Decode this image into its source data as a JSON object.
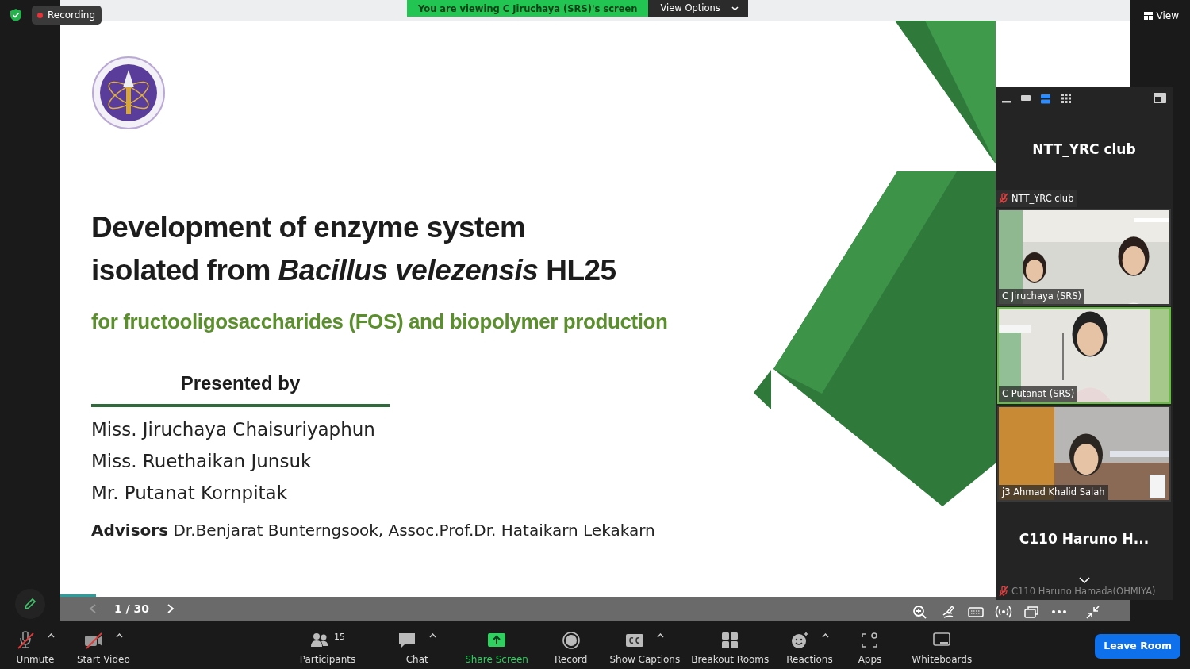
{
  "top_bar": {
    "recording_label": "Recording",
    "banner": "You are viewing C Jiruchaya (SRS)'s screen",
    "view_options": "View Options",
    "view_button": "View"
  },
  "slide": {
    "title_lines": [
      "Development of enzyme system",
      "isolated from *Bacillus velezensis* HL25"
    ],
    "subtitle": "for fructooligosaccharides (FOS) and biopolymer production",
    "presented_by": "Presented by",
    "presenters": [
      "Miss. Jiruchaya Chaisuriyaphun",
      "Miss. Ruethaikan Junsuk",
      "Mr. Putanat Kornpitak"
    ],
    "advisors": "**Advisors** Dr.Benjarat Bunterngsook, Assoc.Prof.Dr. Hataikarn Lekakarn"
  },
  "share_controls": {
    "page": "1 / 30",
    "level": 0.033
  },
  "video_panel": {
    "layouts": [
      {
        "kind": "minimize",
        "selected": false
      },
      {
        "kind": "thumbnail",
        "selected": false
      },
      {
        "kind": "speaker",
        "selected": true
      },
      {
        "kind": "gallery",
        "selected": false
      }
    ],
    "tiles": [
      {
        "kind": "name",
        "big_name": "NTT_YRC club",
        "label": "NTT_YRC club",
        "muted": true,
        "active": false
      },
      {
        "kind": "video",
        "label": "C Jiruchaya (SRS)",
        "active": false
      },
      {
        "kind": "video",
        "label": "C Putanat (SRS)",
        "active": true
      },
      {
        "kind": "video",
        "label": "j3 Ahmad Khalid Salah",
        "active": false
      },
      {
        "kind": "name",
        "big_name": "C110 Haruno H...",
        "label": "C110 Haruno Hamada(OHMIYA)",
        "muted": true,
        "active": false
      }
    ]
  },
  "toolbar": [
    {
      "kind": "mic",
      "label": "Unmute",
      "off": true,
      "has_menu": true
    },
    {
      "kind": "video",
      "label": "Start Video",
      "off": true,
      "has_menu": true
    },
    {
      "kind": "participants",
      "label": "Participants",
      "count": "15",
      "has_menu": false
    },
    {
      "kind": "chat",
      "label": "Chat",
      "has_menu": true
    },
    {
      "kind": "share",
      "label": "Share Screen",
      "has_menu": false
    },
    {
      "kind": "record",
      "label": "Record",
      "has_menu": false
    },
    {
      "kind": "captions",
      "label": "Show Captions",
      "has_menu": true
    },
    {
      "kind": "breakout",
      "label": "Breakout Rooms",
      "has_menu": false
    },
    {
      "kind": "reactions",
      "label": "Reactions",
      "has_menu": true
    },
    {
      "kind": "apps",
      "label": "Apps",
      "has_menu": false
    },
    {
      "kind": "whiteboards",
      "label": "Whiteboards",
      "has_menu": false
    }
  ],
  "leave_button": "Leave Room"
}
